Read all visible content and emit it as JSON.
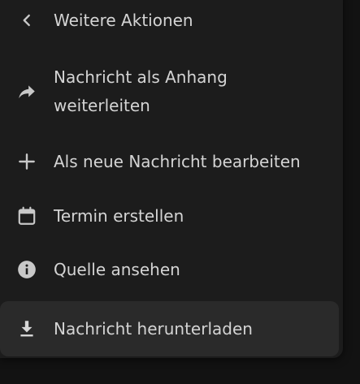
{
  "menu": {
    "back": {
      "label": "Weitere Aktionen",
      "icon": "chevron-left-icon"
    },
    "items": [
      {
        "label": "Nachricht als Anhang weiterleiten",
        "icon": "share-arrow-icon"
      },
      {
        "label": "Als neue Nachricht bearbeiten",
        "icon": "plus-icon"
      },
      {
        "label": "Termin erstellen",
        "icon": "calendar-icon"
      },
      {
        "label": "Quelle ansehen",
        "icon": "info-icon"
      },
      {
        "label": "Nachricht herunterladen",
        "icon": "download-icon"
      }
    ]
  },
  "colors": {
    "background": "#121212",
    "menu_background": "#1c1c1c",
    "hover_background": "#2a2a2a",
    "text": "#d4d4d4",
    "icon": "#c8c8c8"
  }
}
